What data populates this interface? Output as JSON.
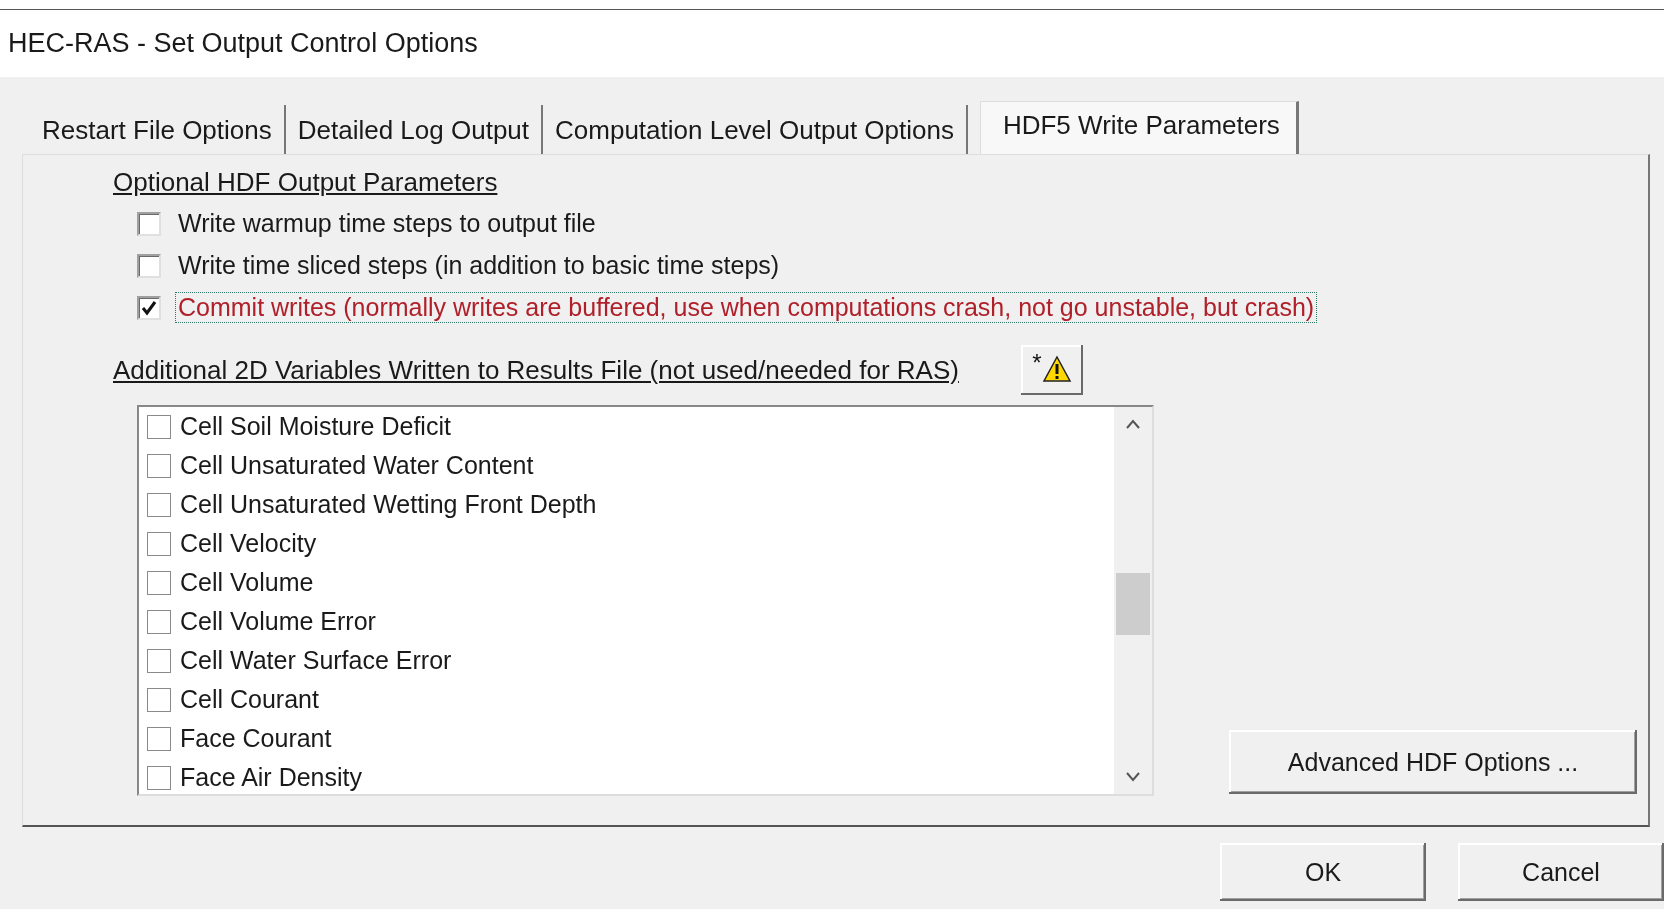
{
  "window": {
    "title": "HEC-RAS - Set Output Control Options"
  },
  "tabs": [
    {
      "label": "Restart File Options",
      "selected": false
    },
    {
      "label": "Detailed Log Output",
      "selected": false
    },
    {
      "label": "Computation Level Output Options",
      "selected": false
    },
    {
      "label": "HDF5 Write Parameters",
      "selected": true
    }
  ],
  "optional_hdf_output": {
    "heading": "Optional HDF Output Parameters",
    "options": [
      {
        "label": "Write warmup time steps to output file",
        "checked": false,
        "focused": false,
        "emphasized": false
      },
      {
        "label": "Write time sliced steps (in addition to basic time steps)",
        "checked": false,
        "focused": false,
        "emphasized": false
      },
      {
        "label": "Commit writes (normally writes are buffered, use when computations crash, not go unstable, but crash)",
        "checked": true,
        "focused": true,
        "emphasized": true
      }
    ]
  },
  "additional_2d_variables": {
    "heading": "Additional 2D Variables Written to Results File (not used/needed for RAS)",
    "warning_button": {
      "label": "*"
    },
    "items": [
      {
        "label": "Cell Soil Moisture Deficit",
        "checked": false
      },
      {
        "label": "Cell Unsaturated Water Content",
        "checked": false
      },
      {
        "label": "Cell Unsaturated Wetting Front Depth",
        "checked": false
      },
      {
        "label": "Cell Velocity",
        "checked": false
      },
      {
        "label": "Cell Volume",
        "checked": false
      },
      {
        "label": "Cell Volume Error",
        "checked": false
      },
      {
        "label": "Cell Water Surface Error",
        "checked": false
      },
      {
        "label": "Cell Courant",
        "checked": false
      },
      {
        "label": "Face Courant",
        "checked": false
      },
      {
        "label": "Face Air Density",
        "checked": false
      }
    ]
  },
  "advanced_button": "Advanced HDF Options ...",
  "buttons": [
    "OK",
    "Cancel"
  ]
}
